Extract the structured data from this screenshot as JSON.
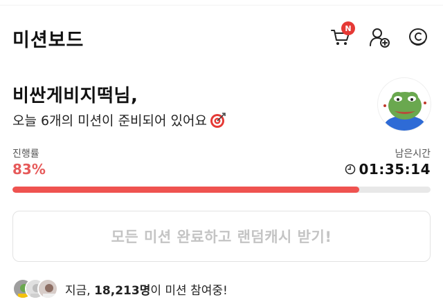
{
  "header": {
    "title": "미션보드",
    "cart_badge": "N"
  },
  "greeting": {
    "name": "비싼게비지떡님,",
    "subtitle": "오늘 6개의 미션이 준비되어 있어요"
  },
  "progress": {
    "label": "진행률",
    "value_text": "83%",
    "fraction": 0.83
  },
  "timer": {
    "label": "남은시간",
    "value": "01:35:14"
  },
  "cta": {
    "label": "모든 미션 완료하고 랜덤캐시 받기!"
  },
  "participants": {
    "prefix": "지금, ",
    "count": "18,213명",
    "suffix": "이 미션 참여중!"
  },
  "colors": {
    "accent": "#ef5350",
    "progress_text": "#e65a5a",
    "cta_text": "#c4c4c4"
  },
  "icons": [
    "cart-icon",
    "add-user-icon",
    "coin-icon",
    "clock-icon",
    "target-icon"
  ]
}
